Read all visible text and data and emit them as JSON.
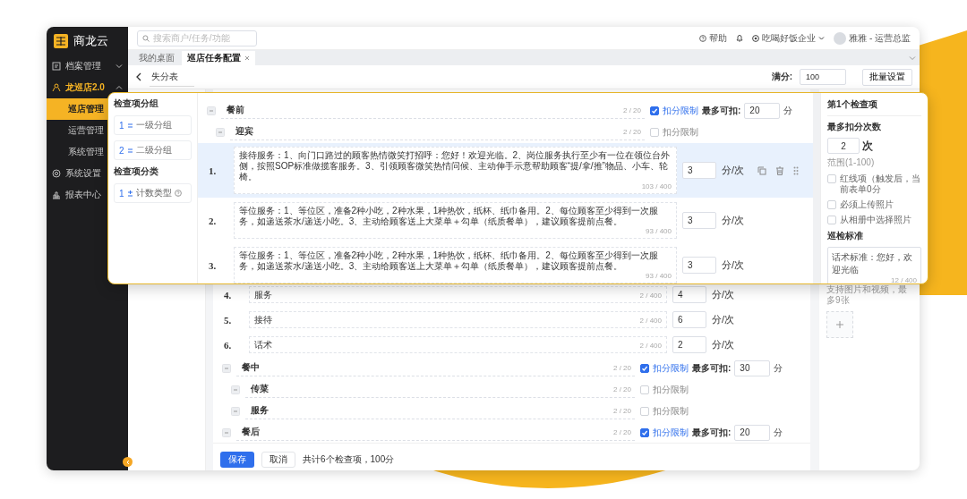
{
  "sidebar": {
    "logo": "商龙云",
    "items": [
      {
        "kind": "group",
        "label": "档案管理",
        "selected": false,
        "expanded": false
      },
      {
        "kind": "group",
        "label": "龙巡店2.0",
        "selected": true,
        "expanded": true,
        "children": [
          {
            "label": "巡店管理",
            "selected": true
          },
          {
            "label": "运营管理",
            "selected": false
          },
          {
            "label": "系统管理",
            "selected": false
          }
        ]
      },
      {
        "kind": "link",
        "label": "系统设置",
        "selected": false
      },
      {
        "kind": "link",
        "label": "报表中心",
        "selected": false
      }
    ]
  },
  "topbar": {
    "search_placeholder": "搜索商户/任务/功能",
    "help": "帮助",
    "company": "吃喝好饭企业",
    "user": "雅雅 - 运营总监"
  },
  "tabs": [
    {
      "label": "我的桌面",
      "selected": false,
      "closable": false
    },
    {
      "label": "巡店任务配置",
      "selected": true,
      "closable": true
    }
  ],
  "header": {
    "title": "失分表",
    "full_score_label": "满分:",
    "full_score": "100",
    "batch_button": "批量设置"
  },
  "callout": {
    "group_panel": {
      "group_title": "检查项分组",
      "groups": [
        {
          "index": "1",
          "label": "一级分组"
        },
        {
          "index": "2",
          "label": "二级分组"
        }
      ],
      "type_title": "检查项分类",
      "types": [
        {
          "index": "1",
          "label": "计数类型"
        }
      ]
    },
    "tree": [
      {
        "kind": "group",
        "label": "餐前",
        "count": "2 / 20",
        "limit_label": "扣分限制",
        "limited": true,
        "max_label": "最多可扣:",
        "max": "20",
        "unit": "分",
        "children": [
          {
            "kind": "group",
            "label": "迎宾",
            "count": "2 / 20",
            "limit_label": "扣分限制",
            "limited": false,
            "children": [
              {
                "kind": "item",
                "number": "1.",
                "text": "接待服务：1、向门口路过的顾客热情微笑打招呼：您好！欢迎光临。2、岗位服务执行至少有一位在领位台外侧，按照SOP标准做揽客服务。3、引领顾客微笑热情问候、主动伸手示意帮助顾客“提/拿/推”物品、小车、轮椅。",
                "count": "103 / 400",
                "score": "3",
                "unit": "分/次",
                "selected": true
              },
              {
                "kind": "item",
                "number": "2.",
                "text": "等位服务：1、等位区，准备2种小吃，2种水果，1种热饮，纸杯、纸巾备用。2、每位顾客至少得到一次服务，如递送茶水/递送小吃。3、主动给顾客送上大菜单＋勾单（纸质餐单），建议顾客提前点餐。",
                "count": "93 / 400",
                "score": "3",
                "unit": "分/次",
                "selected": false
              },
              {
                "kind": "item",
                "number": "3.",
                "text": "等位服务：1、等位区，准备2种小吃，2种水果，1种热饮，纸杯、纸巾备用。2、每位顾客至少得到一次服务，如递送茶水/递送小吃。3、主动给顾客送上大菜单＋勾单（纸质餐单），建议顾客提前点餐。",
                "count": "93 / 400",
                "score": "3",
                "unit": "分/次",
                "selected": false
              }
            ]
          }
        ]
      }
    ],
    "detail": {
      "title": "第1个检查项",
      "max_label": "最多扣分次数",
      "max_value": "2",
      "max_unit": "次",
      "range": "范围(1-100)",
      "options": [
        {
          "label": "红线项（触发后，当前表单0分",
          "checked": false
        },
        {
          "label": "必须上传照片",
          "checked": false
        },
        {
          "label": "从相册中选择照片",
          "checked": false
        }
      ],
      "standard_label": "巡检标准",
      "standard_text": "话术标准：您好，欢迎光临",
      "standard_count": "12 / 400"
    }
  },
  "content": {
    "rows": [
      {
        "kind": "item",
        "number": "4.",
        "text": "服务",
        "count": "2 / 400",
        "score": "4",
        "unit": "分/次",
        "selected": false
      },
      {
        "kind": "item",
        "number": "5.",
        "text": "接待",
        "count": "2 / 400",
        "score": "6",
        "unit": "分/次",
        "selected": false
      },
      {
        "kind": "item",
        "number": "6.",
        "text": "话术",
        "count": "2 / 400",
        "score": "2",
        "unit": "分/次",
        "selected": false
      },
      {
        "kind": "group",
        "label": "餐中",
        "count": "2 / 20",
        "limit_label": "扣分限制",
        "limited": true,
        "max_label": "最多可扣:",
        "max": "30",
        "unit": "分",
        "children": [
          {
            "kind": "group",
            "label": "传菜",
            "count": "2 / 20",
            "limit_label": "扣分限制",
            "limited": false
          },
          {
            "kind": "group",
            "label": "服务",
            "count": "2 / 20",
            "limit_label": "扣分限制",
            "limited": false
          }
        ]
      },
      {
        "kind": "group",
        "label": "餐后",
        "count": "2 / 20",
        "limit_label": "扣分限制",
        "limited": true,
        "max_label": "最多可扣:",
        "max": "20",
        "unit": "分"
      }
    ]
  },
  "side_panel": {
    "hint": "支持图片和视频，最多9张"
  },
  "footer": {
    "save": "保存",
    "cancel": "取消",
    "summary": "共计6个检查项，100分"
  }
}
